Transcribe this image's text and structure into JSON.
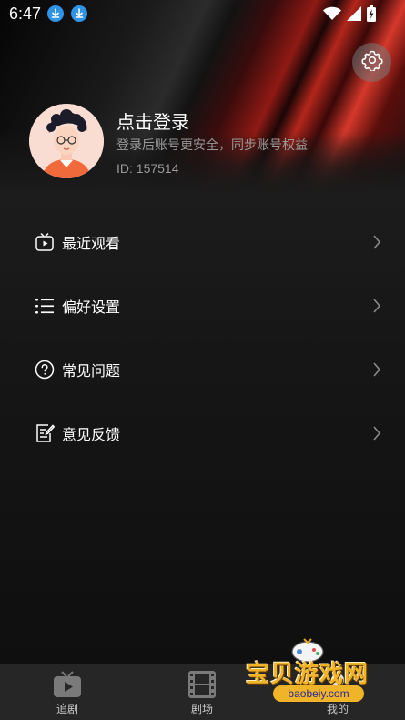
{
  "status_bar": {
    "time": "6:47",
    "icons": [
      "download-icon",
      "download-icon",
      "wifi-icon",
      "signal-icon",
      "battery-charging-icon"
    ]
  },
  "profile": {
    "title": "点击登录",
    "subtitle": "登录后账号更安全，同步账号权益",
    "user_id": "ID: 157514",
    "avatar_icon": "avatar-illustration"
  },
  "menu": {
    "items": [
      {
        "label": "最近观看",
        "icon": "tv-play-icon"
      },
      {
        "label": "偏好设置",
        "icon": "list-settings-icon"
      },
      {
        "label": "常见问题",
        "icon": "help-circle-icon"
      },
      {
        "label": "意见反馈",
        "icon": "feedback-edit-icon"
      }
    ]
  },
  "bottom_nav": {
    "items": [
      {
        "label": "追剧",
        "icon": "tv-icon"
      },
      {
        "label": "剧场",
        "icon": "film-strip-icon"
      },
      {
        "label": "我的",
        "icon": "profile-icon"
      }
    ]
  },
  "watermark": {
    "text": "宝贝游戏网",
    "url": "baobeiy.com"
  },
  "colors": {
    "accent_red": "#b3261b",
    "download_blue": "#2f93e6",
    "subtitle_gray": "#9a9a9a",
    "nav_bg": "#262626"
  }
}
